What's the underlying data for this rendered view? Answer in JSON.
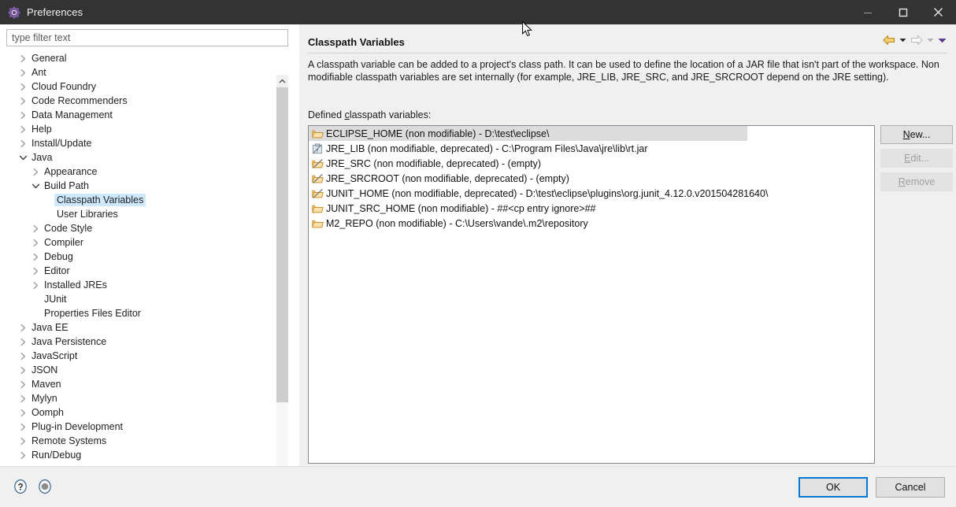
{
  "window": {
    "title": "Preferences",
    "app_icon": "eclipse-preferences-icon",
    "controls": {
      "minimize": "minimize-icon",
      "maximize": "maximize-icon",
      "close": "close-icon"
    }
  },
  "filter": {
    "placeholder": "type filter text",
    "value": ""
  },
  "tree": {
    "items": [
      {
        "label": "General",
        "indent": 0,
        "state": "collapsed"
      },
      {
        "label": "Ant",
        "indent": 0,
        "state": "collapsed"
      },
      {
        "label": "Cloud Foundry",
        "indent": 0,
        "state": "collapsed"
      },
      {
        "label": "Code Recommenders",
        "indent": 0,
        "state": "collapsed"
      },
      {
        "label": "Data Management",
        "indent": 0,
        "state": "collapsed"
      },
      {
        "label": "Help",
        "indent": 0,
        "state": "collapsed"
      },
      {
        "label": "Install/Update",
        "indent": 0,
        "state": "collapsed"
      },
      {
        "label": "Java",
        "indent": 0,
        "state": "expanded"
      },
      {
        "label": "Appearance",
        "indent": 1,
        "state": "collapsed"
      },
      {
        "label": "Build Path",
        "indent": 1,
        "state": "expanded"
      },
      {
        "label": "Classpath Variables",
        "indent": 2,
        "state": "leaf",
        "selected": true
      },
      {
        "label": "User Libraries",
        "indent": 2,
        "state": "leaf"
      },
      {
        "label": "Code Style",
        "indent": 1,
        "state": "collapsed"
      },
      {
        "label": "Compiler",
        "indent": 1,
        "state": "collapsed"
      },
      {
        "label": "Debug",
        "indent": 1,
        "state": "collapsed"
      },
      {
        "label": "Editor",
        "indent": 1,
        "state": "collapsed"
      },
      {
        "label": "Installed JREs",
        "indent": 1,
        "state": "collapsed"
      },
      {
        "label": "JUnit",
        "indent": 1,
        "state": "leaf"
      },
      {
        "label": "Properties Files Editor",
        "indent": 1,
        "state": "leaf"
      },
      {
        "label": "Java EE",
        "indent": 0,
        "state": "collapsed"
      },
      {
        "label": "Java Persistence",
        "indent": 0,
        "state": "collapsed"
      },
      {
        "label": "JavaScript",
        "indent": 0,
        "state": "collapsed"
      },
      {
        "label": "JSON",
        "indent": 0,
        "state": "collapsed"
      },
      {
        "label": "Maven",
        "indent": 0,
        "state": "collapsed"
      },
      {
        "label": "Mylyn",
        "indent": 0,
        "state": "collapsed"
      },
      {
        "label": "Oomph",
        "indent": 0,
        "state": "collapsed"
      },
      {
        "label": "Plug-in Development",
        "indent": 0,
        "state": "collapsed"
      },
      {
        "label": "Remote Systems",
        "indent": 0,
        "state": "collapsed"
      },
      {
        "label": "Run/Debug",
        "indent": 0,
        "state": "collapsed"
      }
    ]
  },
  "page": {
    "title": "Classpath Variables",
    "description": "A classpath variable can be added to a project's class path. It can be used to define the location of a JAR file that isn't part of the workspace. Non modifiable classpath variables are set internally (for example, JRE_LIB, JRE_SRC, and JRE_SRCROOT depend on the JRE setting).",
    "list_label_prefix": "Defined ",
    "list_label_mnemonic": "c",
    "list_label_suffix": "lasspath variables:",
    "nav": {
      "back": "back-arrow-icon",
      "back_menu": "back-dropdown-icon",
      "forward": "forward-arrow-icon",
      "forward_menu": "forward-dropdown-icon",
      "page_menu": "page-menu-dropdown-icon"
    }
  },
  "variables": [
    {
      "icon": "folder-icon",
      "text": "ECLIPSE_HOME (non modifiable) - D:\\test\\eclipse\\",
      "selected": true
    },
    {
      "icon": "jar-file-icon",
      "text": "JRE_LIB (non modifiable, deprecated) - C:\\Program Files\\Java\\jre\\lib\\rt.jar",
      "selected": false
    },
    {
      "icon": "folder-deprecated-icon",
      "text": "JRE_SRC (non modifiable, deprecated) - (empty)",
      "selected": false
    },
    {
      "icon": "folder-deprecated-icon",
      "text": "JRE_SRCROOT (non modifiable, deprecated) - (empty)",
      "selected": false
    },
    {
      "icon": "folder-deprecated-icon",
      "text": "JUNIT_HOME (non modifiable, deprecated) - D:\\test\\eclipse\\plugins\\org.junit_4.12.0.v201504281640\\",
      "selected": false
    },
    {
      "icon": "folder-icon",
      "text": "JUNIT_SRC_HOME (non modifiable) - ##<cp entry ignore>##",
      "selected": false
    },
    {
      "icon": "folder-icon",
      "text": "M2_REPO (non modifiable) - C:\\Users\\vande\\.m2\\repository",
      "selected": false
    }
  ],
  "side_buttons": [
    {
      "id": "new",
      "prefix": "N",
      "rest": "ew...",
      "enabled": true
    },
    {
      "id": "edit",
      "prefix": "E",
      "rest": "dit...",
      "enabled": false
    },
    {
      "id": "remove",
      "prefix": "R",
      "rest": "emove",
      "enabled": false
    }
  ],
  "footer": {
    "help_icon": "help-question-icon",
    "apply_icon": "apply-circle-icon",
    "ok_label": "OK",
    "cancel_label": "Cancel"
  },
  "colors": {
    "titlebar_bg": "#333333",
    "selection_tree": "#cde8ff",
    "selection_list": "#dcdcdc",
    "default_button_border": "#0078d7",
    "folder_icon": "#e8a33d",
    "back_arrow": "#e5a11e",
    "panel_bg": "#f0f0f0"
  }
}
